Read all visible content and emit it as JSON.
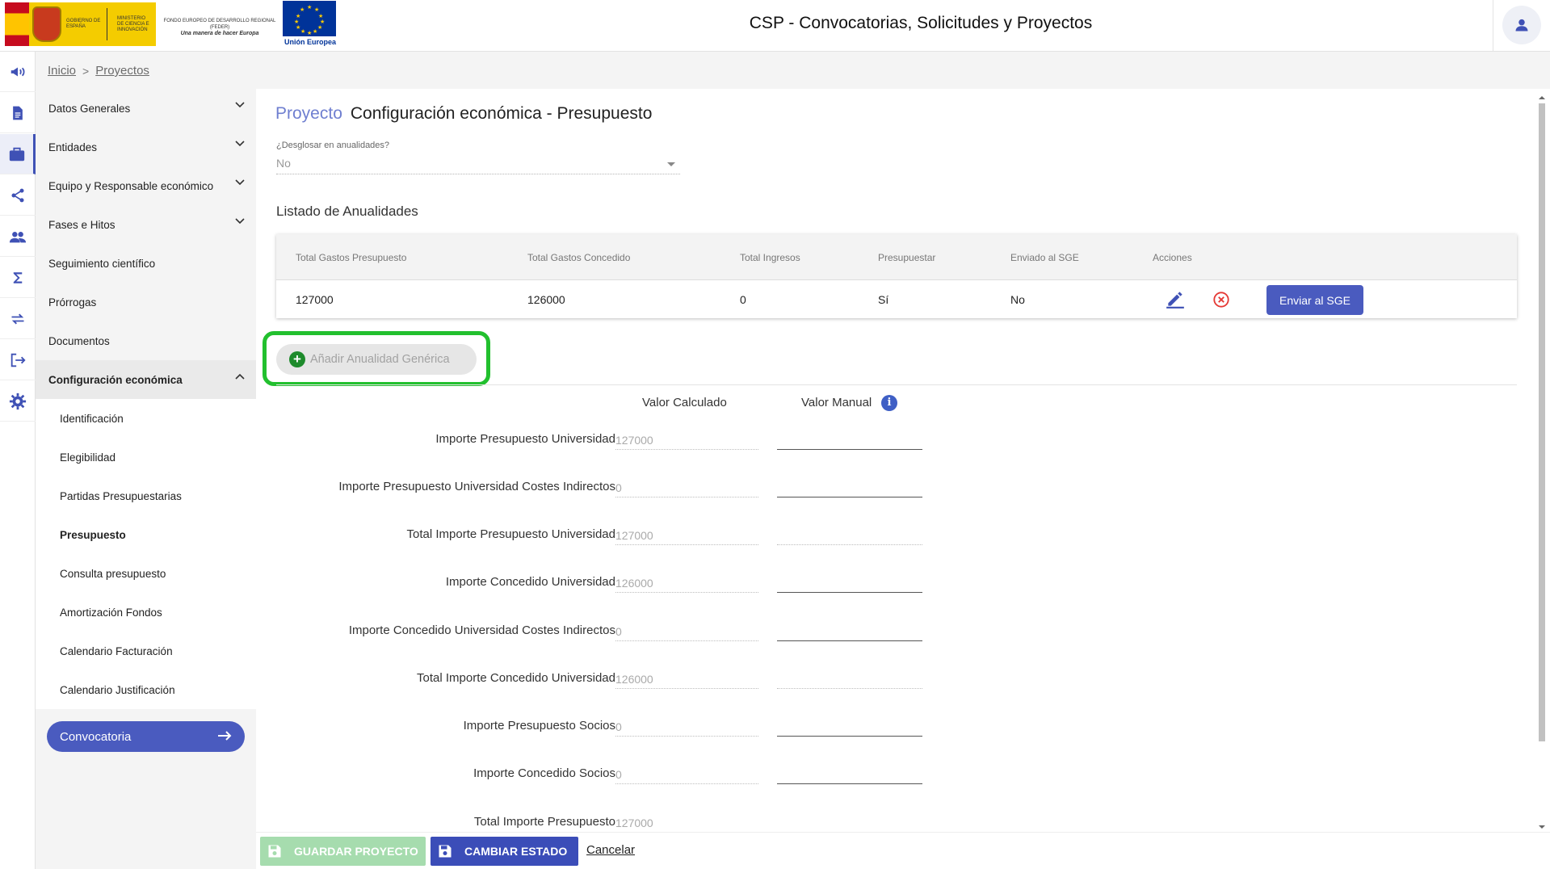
{
  "header": {
    "gov_logo_text": "GOBIERNO DE ESPAÑA",
    "ministry_text": "MINISTERIO DE CIENCIA E INNOVACIÓN",
    "feder_text": "FONDO EUROPEO DE DESARROLLO REGIONAL (FEDER)",
    "feder_slogan": "Una manera de hacer Europa",
    "eu_label": "Unión Europea",
    "app_title": "CSP - Convocatorias, Solicitudes y Proyectos"
  },
  "rail_icons": [
    "megaphone-icon",
    "document-icon",
    "briefcase-icon",
    "share-icon",
    "group-icon",
    "sigma-icon",
    "swap-icon",
    "logout-icon",
    "gear-icon"
  ],
  "breadcrumb": {
    "items": [
      "Inicio",
      "Proyectos"
    ],
    "separator": ">"
  },
  "sidebar": {
    "items": [
      {
        "label": "Datos Generales"
      },
      {
        "label": "Entidades"
      },
      {
        "label": "Equipo y Responsable económico"
      },
      {
        "label": "Fases e Hitos"
      },
      {
        "label": "Seguimiento científico"
      },
      {
        "label": "Prórrogas"
      },
      {
        "label": "Documentos"
      },
      {
        "label": "Configuración económica"
      }
    ],
    "sub_items": [
      {
        "label": "Identificación"
      },
      {
        "label": "Elegibilidad"
      },
      {
        "label": "Partidas Presupuestarias"
      },
      {
        "label": "Presupuesto"
      },
      {
        "label": "Consulta presupuesto"
      },
      {
        "label": "Amortización Fondos"
      },
      {
        "label": "Calendario Facturación"
      },
      {
        "label": "Calendario Justificación"
      }
    ],
    "convocatoria_button": "Convocatoria"
  },
  "main": {
    "title_prefix": "Proyecto",
    "title": "Configuración económica - Presupuesto",
    "desglosar_label": "¿Desglosar en anualidades?",
    "desglosar_value": "No",
    "section_title": "Listado de Anualidades",
    "table": {
      "headers": [
        "Total Gastos Presupuesto",
        "Total Gastos Concedido",
        "Total Ingresos",
        "Presupuestar",
        "Enviado al SGE",
        "Acciones"
      ],
      "rows": [
        [
          "127000",
          "126000",
          "0",
          "Sí",
          "No"
        ]
      ],
      "send_button": "Enviar al SGE"
    },
    "add_button": "Añadir Anualidad Genérica",
    "calc_header": "Valor Calculado",
    "manual_header": "Valor Manual",
    "rows": [
      {
        "label": "Importe Presupuesto Universidad",
        "calc": "127000",
        "manual": ""
      },
      {
        "label": "Importe Presupuesto Universidad Costes Indirectos",
        "calc": "0",
        "manual": ""
      },
      {
        "label": "Total Importe Presupuesto Universidad",
        "calc": "127000",
        "manual": ""
      },
      {
        "label": "Importe Concedido Universidad",
        "calc": "126000",
        "manual": ""
      },
      {
        "label": "Importe Concedido Universidad Costes Indirectos",
        "calc": "0",
        "manual": ""
      },
      {
        "label": "Total Importe Concedido Universidad",
        "calc": "126000",
        "manual": ""
      },
      {
        "label": "Importe Presupuesto Socios",
        "calc": "0",
        "manual": ""
      },
      {
        "label": "Importe Concedido Socios",
        "calc": "0",
        "manual": ""
      },
      {
        "label": "Total Importe Presupuesto",
        "calc": "127000",
        "manual": ""
      }
    ]
  },
  "footer": {
    "save_button": "GUARDAR PROYECTO",
    "change_state_button": "CAMBIAR ESTADO",
    "cancel_link": "Cancelar"
  },
  "colors": {
    "accent": "#4a5bbf",
    "title_prefix": "#6f7fd0",
    "highlight": "#22c02e",
    "delete": "#e53935",
    "save_disabled": "#a6dcae"
  }
}
